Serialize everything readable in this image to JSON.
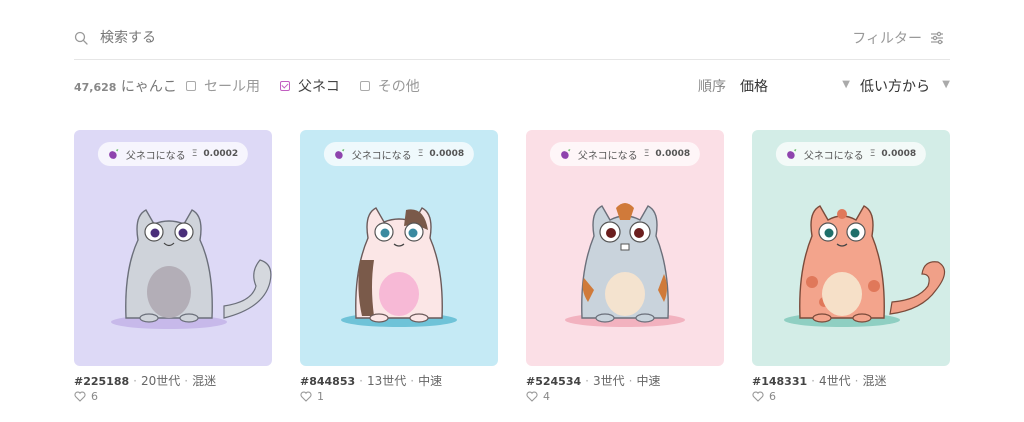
{
  "search": {
    "placeholder": "検索する",
    "filter_label": "フィルター"
  },
  "toolbar": {
    "count_number": "47,628",
    "count_unit": "にゃんこ",
    "filters": [
      {
        "label": "セール用",
        "checked": false
      },
      {
        "label": "父ネコ",
        "checked": true
      },
      {
        "label": "その他",
        "checked": false
      }
    ],
    "sort_label": "順序",
    "sort_value": "価格",
    "order_value": "低い方から"
  },
  "cards": [
    {
      "bg": "#ddd9f6",
      "pill_label": "父ネコになる",
      "eth_symbol": "Ξ",
      "price": "0.0002",
      "id": "#225188",
      "generation": "20世代",
      "speed": "混迷",
      "likes": "6",
      "cat": "gray"
    },
    {
      "bg": "#c5eaf5",
      "pill_label": "父ネコになる",
      "eth_symbol": "Ξ",
      "price": "0.0008",
      "id": "#844853",
      "generation": "13世代",
      "speed": "中速",
      "likes": "1",
      "cat": "calico"
    },
    {
      "bg": "#fbdfe6",
      "pill_label": "父ネコになる",
      "eth_symbol": "Ξ",
      "price": "0.0008",
      "id": "#524534",
      "generation": "3世代",
      "speed": "中速",
      "likes": "4",
      "cat": "tabby"
    },
    {
      "bg": "#d3ede7",
      "pill_label": "父ネコになる",
      "eth_symbol": "Ξ",
      "price": "0.0008",
      "id": "#148331",
      "generation": "4世代",
      "speed": "混迷",
      "likes": "6",
      "cat": "orange"
    }
  ],
  "colors": {
    "accent": "#c25fc1",
    "divider": "#e6e6e6"
  },
  "icons": {
    "search": "search-icon",
    "filter": "sliders-icon",
    "pill": "eggplant-icon",
    "like": "heart-icon"
  }
}
